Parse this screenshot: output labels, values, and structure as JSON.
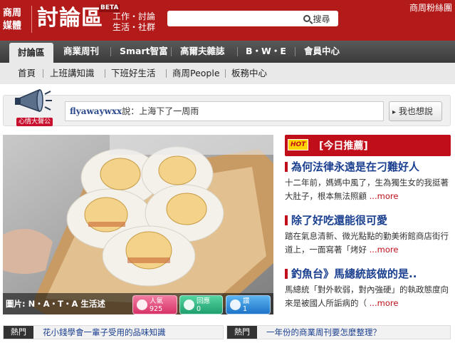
{
  "header": {
    "brand": [
      "商周",
      "媒體"
    ],
    "site_title": "討論區",
    "beta": "BETA",
    "tagline": [
      "工作・討論",
      "生活・社群"
    ],
    "search_button": "搜尋",
    "fan_link": "商周粉絲團"
  },
  "main_nav": [
    "討論區",
    "商業周刊",
    "Smart智富",
    "高爾夫雜誌",
    "B・W・E",
    "會員中心"
  ],
  "sub_nav": [
    "首頁",
    "上班講知識",
    "下班好生活",
    "商周People",
    "板務中心"
  ],
  "shout": {
    "label": "心情大聲公",
    "user": "flyawaywxx",
    "said": "說：",
    "message": "上海下了一周雨",
    "button": "我也想說"
  },
  "feature": {
    "caption": "圖片: N・A・T・A 生活述",
    "stats": [
      {
        "label": "人氣",
        "value": "925"
      },
      {
        "label": "回應",
        "value": "0"
      },
      {
        "label": "讚",
        "value": "1"
      }
    ]
  },
  "recommend": {
    "hot": "HOT",
    "title": "[今日推薦]",
    "articles": [
      {
        "title": "為何法律永遠是在刁難好人",
        "body": "十二年前，媽媽中風了，生為獨生女的我挺著大肚子，根本無法照顧",
        "more": "...more"
      },
      {
        "title": "除了好吃還能很可愛",
        "body": "踏在氣息清新、微光點點的勤美術館商店街行道上，一面寫著「烤好",
        "more": "...more"
      },
      {
        "title": "釣魚台》馬總統該做的是..",
        "body": "馬總統「對外軟弱，對內強硬」的執政態度向來是被國人所詬病的（",
        "more": "...more"
      }
    ]
  },
  "hot_bar": {
    "label": "熱門",
    "items": [
      "花小錢學會一輩子受用的品味知識",
      "一年份的商業周刊要怎麼整理？"
    ]
  },
  "colors": {
    "brand_red": "#b31a1a",
    "nav_dark": "#444444",
    "link_blue": "#1a3f8f"
  }
}
